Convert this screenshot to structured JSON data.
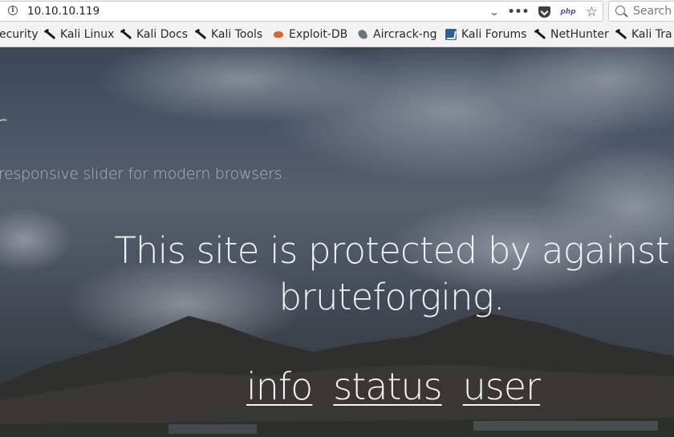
{
  "browser": {
    "url": "10.10.10.119",
    "search_placeholder": "Search",
    "php_badge": "php",
    "bookmarks": [
      {
        "label": "ecurity",
        "icon": "kali-dragon-icon"
      },
      {
        "label": "Kali Linux",
        "icon": "kali-dragon-icon"
      },
      {
        "label": "Kali Docs",
        "icon": "kali-dragon-icon"
      },
      {
        "label": "Kali Tools",
        "icon": "kali-dragon-icon"
      },
      {
        "label": "Exploit-DB",
        "icon": "exploit-db-icon"
      },
      {
        "label": "Aircrack-ng",
        "icon": "aircrack-icon"
      },
      {
        "label": "Kali Forums",
        "icon": "kali-forums-icon"
      },
      {
        "label": "NetHunter",
        "icon": "kali-dragon-icon"
      },
      {
        "label": "Kali Tra",
        "icon": "kali-dragon-icon"
      }
    ]
  },
  "page": {
    "slider_title": "r",
    "slider_subtitle": "responsive slider for modern browsers.",
    "protect_line1": "This site is protected by against",
    "protect_line2": "bruteforging.",
    "links": [
      "info",
      "status",
      "user"
    ]
  }
}
